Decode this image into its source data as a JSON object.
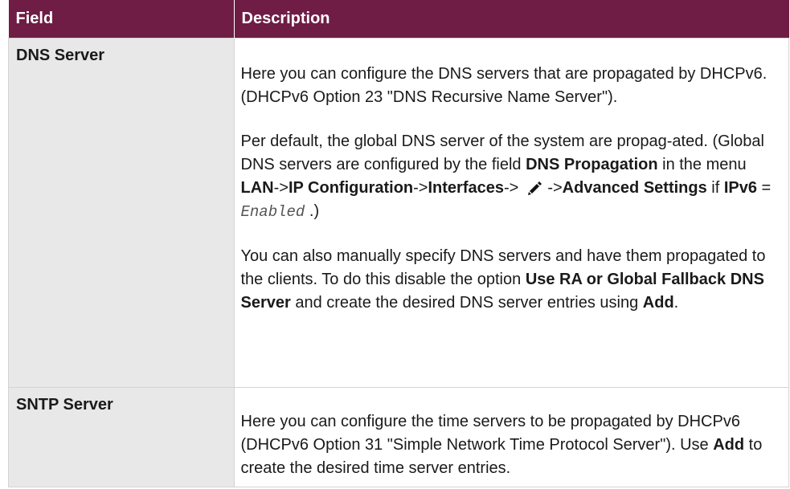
{
  "table": {
    "header": {
      "field": "Field",
      "description": "Description"
    },
    "rows": [
      {
        "field": "DNS Server",
        "p1": "Here you can configure the DNS servers that are propagated by DHCPv6. (DHCPv6 Option 23 \"DNS Recursive Name Server\").",
        "p2": {
          "t1": "Per default, the global DNS server of the system are propag-ated. (Global DNS servers are configured by the field ",
          "b1": "DNS Propagation",
          "t2": " in the menu ",
          "b2": "LAN",
          "t3": "->",
          "b3": "IP Configuration",
          "t4": "->",
          "b4": "Interfaces",
          "t5": "->",
          "icon": "pencil-edit-icon",
          "t6": "->",
          "b5": "Advanced Settings",
          "t7": " if ",
          "b6": "IPv6",
          "t8": " = ",
          "code": "Enabled",
          "t9": " .)"
        },
        "p3": {
          "t1": "You can also manually specify DNS servers and have them propagated to the clients. To do this disable the option ",
          "b1": "Use RA or Global Fallback DNS Server",
          "t2": " and create the desired DNS server entries using ",
          "b2": "Add",
          "t3": "."
        }
      },
      {
        "field": "SNTP Server",
        "p1": {
          "t1": "Here you can configure the time servers to be propagated by DHCPv6 (DHCPv6 Option 31 \"Simple Network Time Protocol Server\"). Use ",
          "b1": "Add",
          "t2": " to create the desired time server entries."
        }
      }
    ]
  }
}
